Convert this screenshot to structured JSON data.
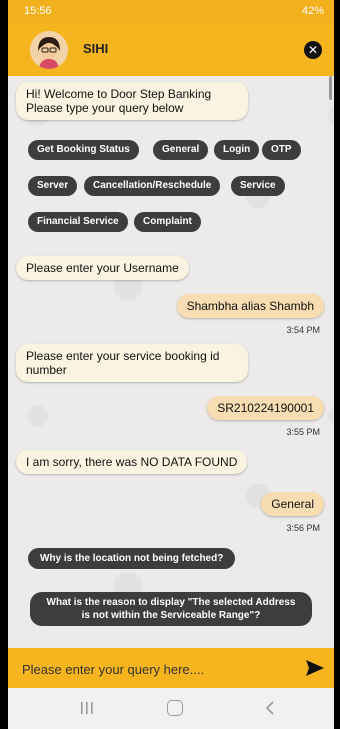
{
  "status_bar": {
    "time": "15:56",
    "right": "42%"
  },
  "header": {
    "title": "SIHI",
    "close_label": "✕"
  },
  "chat": {
    "welcome": "Hi! Welcome to Door Step Banking\nPlease type your query below",
    "chips": [
      "Get Booking Status",
      "General",
      "Login",
      "OTP",
      "Server",
      "Cancellation/Reschedule",
      "Service",
      "Financial Service",
      "Complaint"
    ],
    "prompt_username": "Please enter your Username",
    "user_username": "Shambha alias Shambh",
    "time_1": "3:54 PM",
    "prompt_booking": "Please enter your service booking id number",
    "user_booking": "SR210224190001",
    "time_2": "3:55 PM",
    "no_data": "I am sorry, there was NO DATA FOUND",
    "user_general": "General",
    "time_3": "3:56 PM",
    "suggestion_1": "Why is the location not being fetched?",
    "suggestion_2": "What is the reason to display \"The selected Address is not within the Serviceable Range\"?"
  },
  "input": {
    "placeholder": "Please enter your query here...."
  },
  "icons": {
    "send": "send-icon",
    "close": "close-icon",
    "recent": "recent-apps-icon",
    "home": "home-icon",
    "back": "back-icon"
  },
  "colors": {
    "accent": "#f4b51e",
    "chip": "#3d3d3d",
    "bot_bubble": "#fbf3e1",
    "user_bubble": "#f7ddb1"
  }
}
